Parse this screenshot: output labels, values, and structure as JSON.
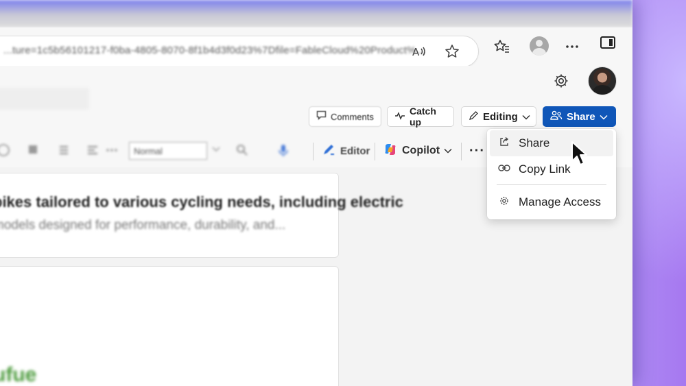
{
  "browser": {
    "url": "...ture=1c5b56101217-f0ba-4805-8070-8f1b4d3f0d23%7Dfile=FableCloud%20Product%...",
    "tab_glyph": "✕",
    "icons": [
      "read-aloud-icon",
      "favorite-star-icon",
      "favorites-icon",
      "profile-icon",
      "more-icon",
      "side-panel-icon"
    ]
  },
  "header": {
    "buttons": {
      "comments": "Comments",
      "catchup": "Catch up",
      "editing": "Editing",
      "share": "Share"
    }
  },
  "ribbon": {
    "style_value": "Normal",
    "editor": "Editor",
    "copilot": "Copilot",
    "more": "···"
  },
  "document": {
    "line1": "bikes tailored to various cycling needs, including electric",
    "line2": "models designed for performance, durability, and...",
    "heading_fragment": "ufue"
  },
  "share_menu": {
    "items": [
      {
        "label": "Share",
        "icon": "share-icon"
      },
      {
        "label": "Copy Link",
        "icon": "link-icon"
      },
      {
        "label": "Manage Access",
        "icon": "gear-icon"
      }
    ]
  },
  "colors": {
    "share_button": "#0f56b8",
    "backdrop": "#8a7cf5"
  }
}
